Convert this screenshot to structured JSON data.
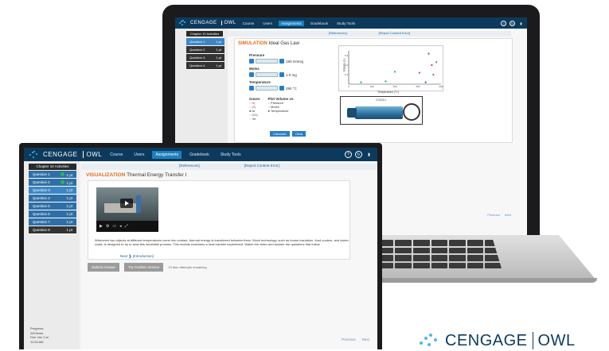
{
  "laptop": {
    "brand": "CENGAGE",
    "product": "OWL",
    "nav": [
      "Course",
      "Users",
      "Assignments",
      "Gradebook",
      "Study Tools"
    ],
    "active_nav": "Assignments",
    "sidebar_title": "Chapter 10 Activities",
    "questions": [
      {
        "label": "Question 1",
        "points": "1 pt"
      },
      {
        "label": "Question 2",
        "points": "1 pt"
      },
      {
        "label": "Question 3",
        "points": "1 pt"
      },
      {
        "label": "Question 4",
        "points": "1 pt"
      }
    ],
    "references": "[References]",
    "report_error": "[Report Content Error]",
    "sim_prefix": "SIMULATION",
    "sim_title": "Ideal Gas Law",
    "controls": {
      "pressure": {
        "label": "Pressure",
        "value": "190 mmHg"
      },
      "moles": {
        "label": "Moles",
        "value": "1.0 mg"
      },
      "temperature": {
        "label": "Temperature",
        "value": "290 °C"
      }
    },
    "gases_label": "Gases",
    "gases": [
      "N₂",
      "O₂",
      "Ar",
      "CO₂",
      "Xe"
    ],
    "plot_label": "Plot Volume vs.",
    "plot_options": [
      "Pressure",
      "Moles",
      "Temperature"
    ],
    "selected_plot": "Temperature",
    "calc_label": "Calculate",
    "clear_label": "Clear",
    "syringe_value": "0.013 L",
    "prev_label": "Previous",
    "next_label": "Next"
  },
  "chart_data": {
    "type": "scatter",
    "title": "",
    "xlabel": "Temperature (°C)",
    "ylabel": "Volume (L)",
    "x_ticks": [
      "0",
      "100",
      "150",
      "250",
      "300"
    ],
    "y_ticks": [
      "0.3",
      "0.2",
      "0.1"
    ],
    "xlim": [
      0,
      300
    ],
    "ylim": [
      0,
      0.35
    ],
    "points": [
      {
        "x": 40,
        "y": 0.02,
        "color": "#2bb35a"
      },
      {
        "x": 120,
        "y": 0.03,
        "color": "#2bb35a"
      },
      {
        "x": 150,
        "y": 0.13,
        "color": "#2bb35a"
      },
      {
        "x": 230,
        "y": 0.12,
        "color": "#9b59b6"
      },
      {
        "x": 260,
        "y": 0.32,
        "color": "#2b6fc4"
      },
      {
        "x": 270,
        "y": 0.2,
        "color": "#c33b3b"
      },
      {
        "x": 275,
        "y": 0.1,
        "color": "#9b59b6"
      },
      {
        "x": 285,
        "y": 0.23,
        "color": "#9b59b6"
      },
      {
        "x": 250,
        "y": 0.02,
        "color": "#2b6fc4"
      }
    ]
  },
  "monitor": {
    "brand": "CENGAGE",
    "product": "OWL",
    "nav": [
      "Course",
      "Users",
      "Assignments",
      "Gradebook",
      "Study Tools"
    ],
    "active_nav": "Assignments",
    "sidebar_title": "Chapter 10 Activities",
    "questions": [
      {
        "label": "Question 1",
        "points": "1 pt",
        "done": true
      },
      {
        "label": "Question 2",
        "points": "1 pt",
        "done": true
      },
      {
        "label": "Question 3",
        "points": "1 pt",
        "done": false
      },
      {
        "label": "Question 4",
        "points": "1 pt",
        "done": false
      },
      {
        "label": "Question 5",
        "points": "1 pt",
        "done": false
      },
      {
        "label": "Question 6",
        "points": "1 pt",
        "done": false
      },
      {
        "label": "Question 7",
        "points": "1 pt",
        "done": false
      },
      {
        "label": "Question 8",
        "points": "1 pt",
        "done": false
      }
    ],
    "references": "[References]",
    "report_error": "[Report Content Error]",
    "sim_prefix": "VISUALIZATION",
    "sim_title": "Thermal Energy Transfer I",
    "description": "Whenever two objects at different temperatures come into contact, thermal energy is transferred between them. Much technology, such as house insulation, food coolers, and winter coats, is designed to try to slow this inevitable process. This module examines a heat transfer experiment. Watch the video and answer the questions that follow.",
    "next_link": "Next",
    "next_link_sub": "(Introduction)",
    "submit_label": "Submit Answer",
    "try_another_label": "Try Another Version",
    "attempts_note": "10 item attempts remaining",
    "progress": [
      "Progress:",
      "2/8 items",
      "Due Jan 1 at",
      "11:00 AM"
    ],
    "prev_label": "Previous",
    "next_label": "Next"
  },
  "corner_brand": {
    "brand": "CENGAGE",
    "product": "OWL"
  }
}
